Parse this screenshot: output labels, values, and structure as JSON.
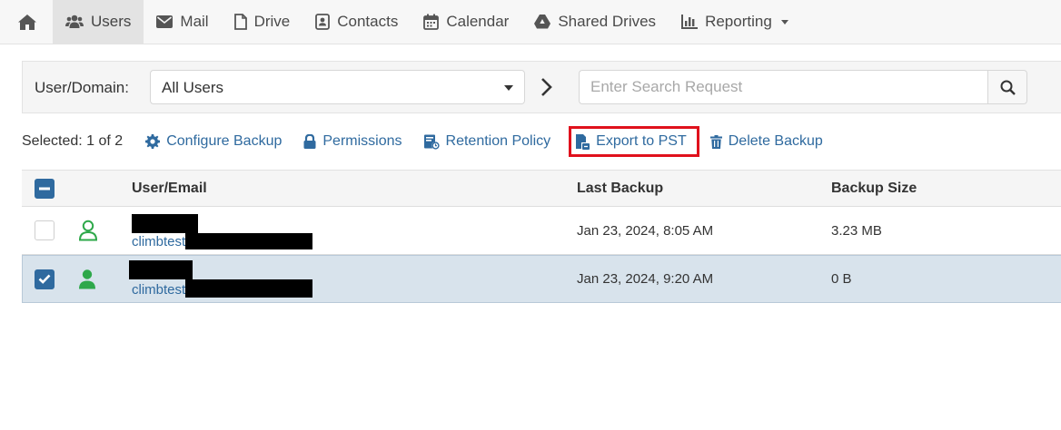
{
  "nav": {
    "home_icon": "home-icon",
    "items": [
      {
        "label": "Users",
        "icon": "users-icon",
        "active": true
      },
      {
        "label": "Mail",
        "icon": "envelope-icon"
      },
      {
        "label": "Drive",
        "icon": "file-icon"
      },
      {
        "label": "Contacts",
        "icon": "contact-card-icon"
      },
      {
        "label": "Calendar",
        "icon": "calendar-icon"
      },
      {
        "label": "Shared Drives",
        "icon": "google-drive-icon"
      },
      {
        "label": "Reporting",
        "icon": "bar-chart-icon",
        "dropdown": true
      }
    ]
  },
  "filter": {
    "label": "User/Domain:",
    "selected": "All Users",
    "search_placeholder": "Enter Search Request"
  },
  "actions": {
    "selected_text": "Selected: 1 of 2",
    "configure": "Configure Backup",
    "permissions": "Permissions",
    "retention": "Retention Policy",
    "export": "Export to PST",
    "delete": "Delete Backup"
  },
  "table": {
    "headers": {
      "user": "User/Email",
      "last_backup": "Last Backup",
      "size": "Backup Size"
    },
    "rows": [
      {
        "email_prefix": "climbtest",
        "last_backup": "Jan 23, 2024, 8:05 AM",
        "size": "3.23 MB",
        "selected": false
      },
      {
        "email_prefix": "climbtest",
        "last_backup": "Jan 23, 2024, 9:20 AM",
        "size": "0 B",
        "selected": true
      }
    ]
  },
  "colors": {
    "accent": "#2f6a9f",
    "highlight_border": "#e0111c",
    "user_green": "#2ea84a",
    "selected_row": "#d8e3ec"
  }
}
